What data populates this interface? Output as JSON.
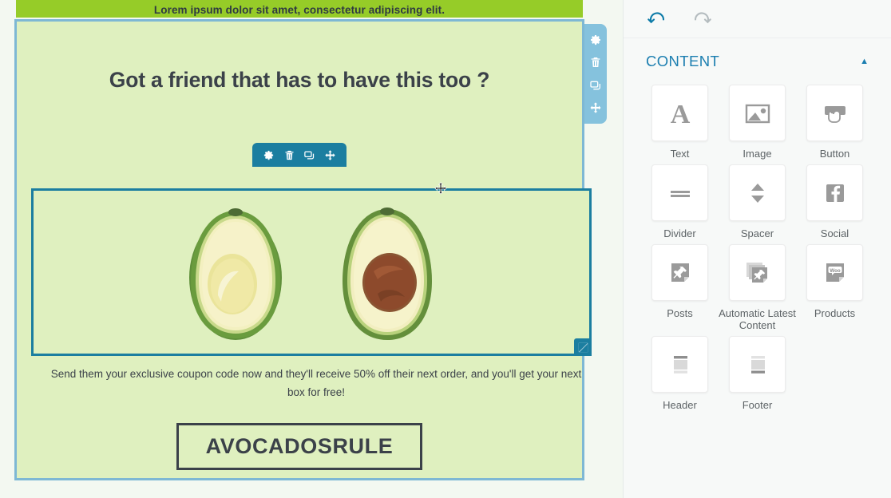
{
  "editor": {
    "banner_text": "Lorem ipsum dolor sit amet, consectetur adipiscing elit.",
    "headline": "Got a friend that has to have this too ?",
    "body_text": "Send them your exclusive coupon code now and they'll receive 50% off their next order, and you'll get your next box for free!",
    "coupon_code": "AVOCADOSRULE",
    "colors": {
      "banner_green": "#96cc28",
      "body_green": "#dff0bf",
      "selected_border": "#1b7ea0",
      "container_border": "#7eb8d4",
      "accent_blue": "#1b7eb0"
    },
    "container_toolbar": [
      {
        "name": "settings",
        "icon": "gear-icon"
      },
      {
        "name": "delete",
        "icon": "trash-icon"
      },
      {
        "name": "duplicate",
        "icon": "copy-icon"
      },
      {
        "name": "move",
        "icon": "move-icon"
      }
    ],
    "block_toolbar": [
      {
        "name": "settings",
        "icon": "gear-icon"
      },
      {
        "name": "delete",
        "icon": "trash-icon"
      },
      {
        "name": "duplicate",
        "icon": "copy-icon"
      },
      {
        "name": "move",
        "icon": "move-icon"
      }
    ],
    "resize_handle_icon": "resize-diagonal-icon",
    "cursor": "move-cursor"
  },
  "sidebar": {
    "history": {
      "undo_label": "Undo",
      "undo_icon": "undo-arrow-icon",
      "redo_label": "Redo",
      "redo_icon": "redo-arrow-icon"
    },
    "section": {
      "title": "CONTENT",
      "collapse_icon": "chevron-up-icon"
    },
    "blocks": [
      {
        "label": "Text",
        "icon": "letter-a-icon"
      },
      {
        "label": "Image",
        "icon": "picture-icon"
      },
      {
        "label": "Button",
        "icon": "button-click-icon"
      },
      {
        "label": "Divider",
        "icon": "divider-lines-icon"
      },
      {
        "label": "Spacer",
        "icon": "up-down-arrows-icon"
      },
      {
        "label": "Social",
        "icon": "facebook-icon"
      },
      {
        "label": "Posts",
        "icon": "pin-note-icon"
      },
      {
        "label": "Automatic Latest Content",
        "icon": "stacked-pin-notes-icon"
      },
      {
        "label": "Products",
        "icon": "woo-note-icon"
      },
      {
        "label": "Header",
        "icon": "header-layout-icon"
      },
      {
        "label": "Footer",
        "icon": "footer-layout-icon"
      }
    ]
  }
}
